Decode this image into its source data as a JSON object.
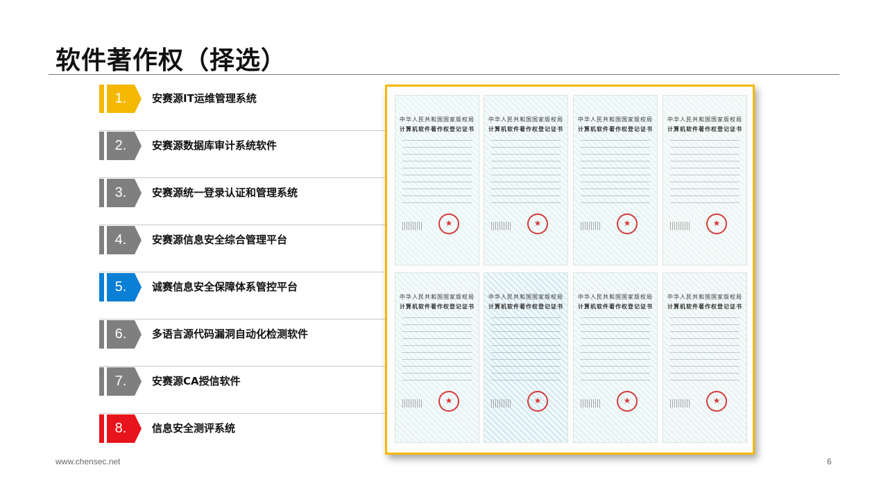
{
  "slide": {
    "title": "软件著作权（择选）",
    "footer_url": "www.chensec.net",
    "page_number": "6"
  },
  "items": [
    {
      "num": "1.",
      "label": "安赛源IT运维管理系统",
      "color": "#f5b800"
    },
    {
      "num": "2.",
      "label": "安赛源数据库审计系统软件",
      "color": "#7f7f7f"
    },
    {
      "num": "3.",
      "label": "安赛源统一登录认证和管理系统",
      "color": "#7f7f7f"
    },
    {
      "num": "4.",
      "label": "安赛源信息安全综合管理平台",
      "color": "#7f7f7f"
    },
    {
      "num": "5.",
      "label": "诚赛信息安全保障体系管控平台",
      "color": "#0a7fd6"
    },
    {
      "num": "6.",
      "label": "多语言源代码漏洞自动化检测软件",
      "color": "#7f7f7f"
    },
    {
      "num": "7.",
      "label": "安赛源CA授信软件",
      "color": "#7f7f7f"
    },
    {
      "num": "8.",
      "label": "信息安全测评系统",
      "color": "#e8141b"
    }
  ],
  "certificates": {
    "header_1": "中华人民共和国国家版权局",
    "header_2": "计算机软件著作权登记证书",
    "count": 8
  },
  "colors": {
    "frame_border": "#f5b800",
    "seal": "#d43a3a"
  }
}
